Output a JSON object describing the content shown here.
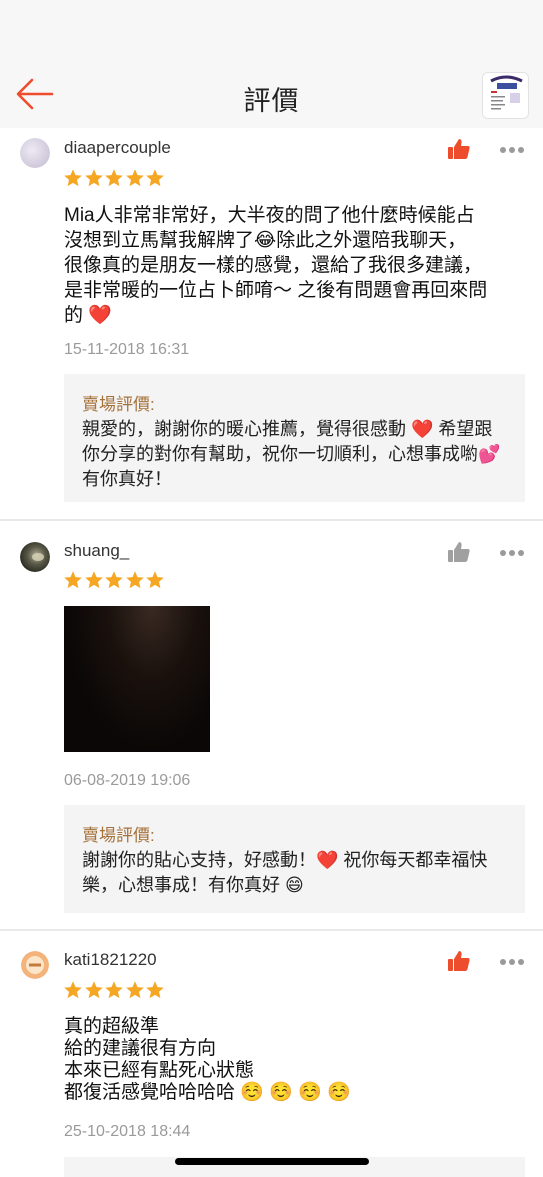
{
  "header": {
    "title": "評價"
  },
  "reviews": [
    {
      "username": "diaapercouple",
      "rating": 5,
      "text": "Mia人非常非常好，大半夜的問了他什麼時候能占\n沒想到立馬幫我解牌了😂除此之外還陪我聊天，\n很像真的是朋友一樣的感覺，還給了我很多建議，\n是非常暖的一位占卜師唷～ 之後有問題會再回來問\n的 ❤️",
      "date": "15-11-2018 16:31",
      "liked": true,
      "reply_title": "賣場評價:",
      "reply_text": "親愛的，謝謝你的暖心推薦，覺得很感動 ❤️ 希望跟你分享的對你有幫助，祝你一切順利，心想事成喲💕 有你真好！"
    },
    {
      "username": "shuang_",
      "rating": 5,
      "text": "",
      "date": "06-08-2019 19:06",
      "liked": false,
      "reply_title": "賣場評價:",
      "reply_text": "謝謝你的貼心支持，好感動！❤️ 祝你每天都幸福快樂，心想事成！有你真好 😄"
    },
    {
      "username": "kati1821220",
      "rating": 5,
      "text": "真的超級準\n給的建議很有方向\n本來已經有點死心狀態\n都復活感覺哈哈哈哈 ☺️ ☺️ ☺️ ☺️",
      "date": "25-10-2018 18:44",
      "liked": true
    }
  ],
  "colors": {
    "accent": "#ee4d2d",
    "star": "#f5a623",
    "reply_title": "#a5713a",
    "like_inactive": "#a0a0a0"
  },
  "icons": {
    "back": "arrow-left-icon",
    "like": "thumbs-up-icon",
    "more": "more-dots-icon",
    "star": "star-icon"
  }
}
